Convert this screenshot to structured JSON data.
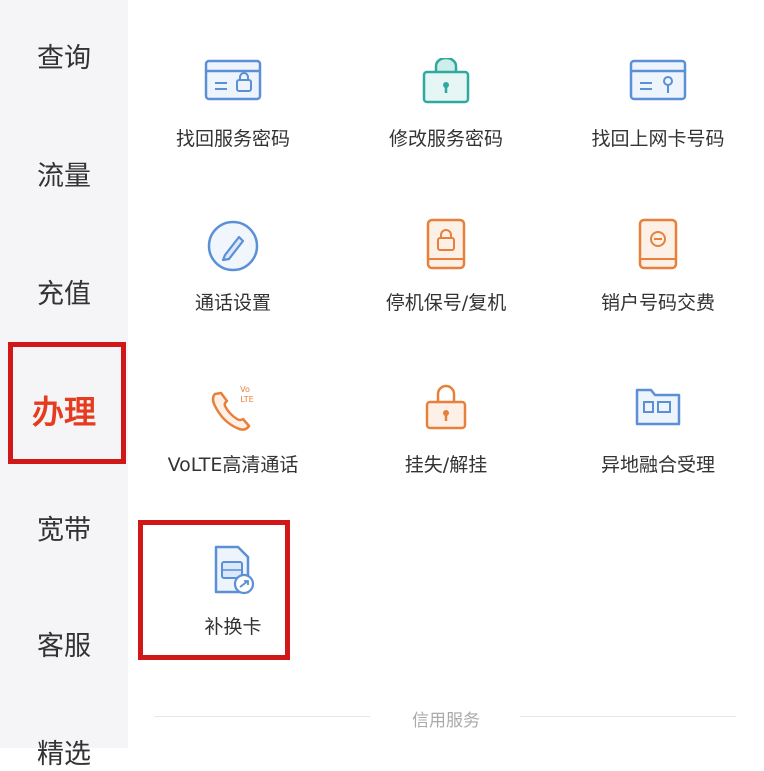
{
  "sidebar": {
    "items": [
      {
        "label": "查询"
      },
      {
        "label": "流量"
      },
      {
        "label": "充值"
      },
      {
        "label": "办理"
      },
      {
        "label": "宽带"
      },
      {
        "label": "客服"
      },
      {
        "label": "精选"
      }
    ],
    "active_index": 3
  },
  "services": [
    {
      "label": "找回服务密码",
      "icon": "card-lock-icon"
    },
    {
      "label": "修改服务密码",
      "icon": "padlock-icon"
    },
    {
      "label": "找回上网卡号码",
      "icon": "card-key-icon"
    },
    {
      "label": "通话设置",
      "icon": "pen-circle-icon"
    },
    {
      "label": "停机保号/复机",
      "icon": "phone-lock-icon"
    },
    {
      "label": "销户号码交费",
      "icon": "phone-minus-icon"
    },
    {
      "label": "VoLTE高清通话",
      "icon": "volte-phone-icon"
    },
    {
      "label": "挂失/解挂",
      "icon": "hanging-lock-icon"
    },
    {
      "label": "异地融合受理",
      "icon": "folder-icon"
    },
    {
      "label": "补换卡",
      "icon": "sim-swap-icon"
    }
  ],
  "section": {
    "title": "信用服务"
  },
  "colors": {
    "accent": "#e63b1f",
    "highlight": "#d01818",
    "icon_blue": "#5b8fd6",
    "icon_teal": "#2fa8a0",
    "icon_orange": "#e8803c"
  }
}
